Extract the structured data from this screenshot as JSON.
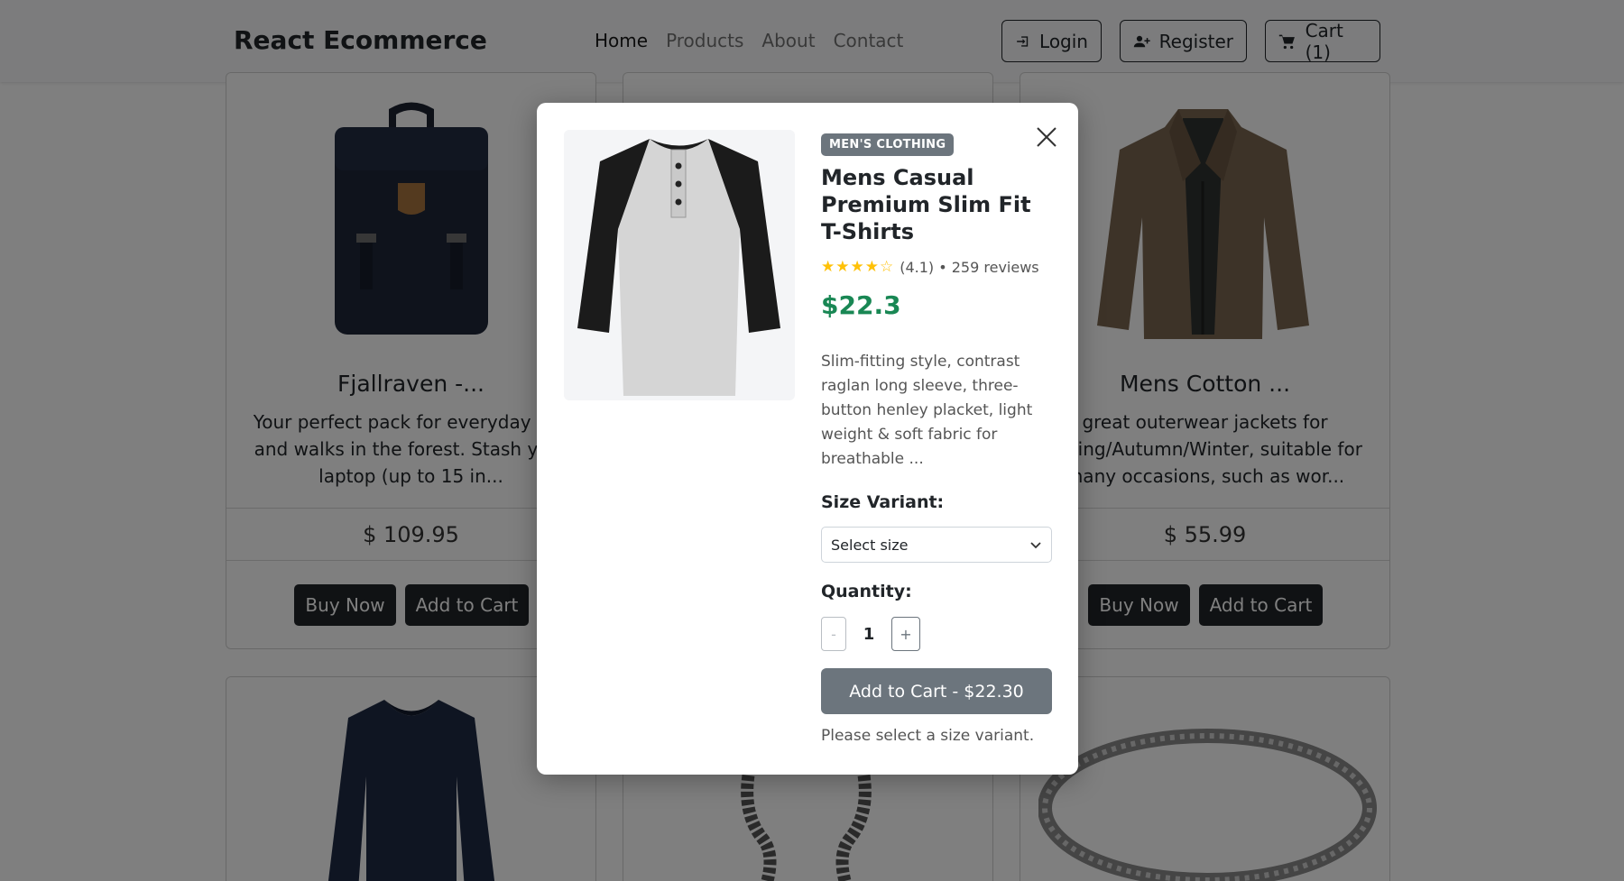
{
  "nav": {
    "brand": "React Ecommerce",
    "links": [
      {
        "label": "Home",
        "active": true
      },
      {
        "label": "Products",
        "active": false
      },
      {
        "label": "About",
        "active": false
      },
      {
        "label": "Contact",
        "active": false
      }
    ],
    "login_label": "Login",
    "register_label": "Register",
    "cart_label": "Cart (1)"
  },
  "products": [
    {
      "title": "Fjallraven -...",
      "description": "Your perfect pack for everyday use and walks in the forest. Stash your laptop (up to 15 in...",
      "price": "$ 109.95"
    },
    {
      "title": "Mens Cotton ...",
      "description": "great outerwear jackets for Spring/Autumn/Winter, suitable for many occasions, such as wor...",
      "price": "$ 55.99"
    }
  ],
  "card_buttons": {
    "buy_now": "Buy Now",
    "add_to_cart": "Add to Cart"
  },
  "modal": {
    "category": "MEN'S CLOTHING",
    "title": "Mens Casual Premium Slim Fit T-Shirts",
    "rating_stars": "★★★★☆",
    "rating_text": "(4.1) • 259 reviews",
    "price": "$22.3",
    "description": "Slim-fitting style, contrast raglan long sleeve, three-button henley placket, light weight & soft fabric for breathable ...",
    "size_label": "Size Variant:",
    "size_select": {
      "selected": "Select size"
    },
    "quantity_label": "Quantity:",
    "quantity": {
      "decrement": "-",
      "value": "1",
      "increment": "+"
    },
    "add_button": "Add to Cart - $22.30",
    "hint": "Please select a size variant."
  },
  "colors": {
    "accent_price": "#198754",
    "badge": "#6c757d",
    "dark_button": "#212529",
    "star": "#ffc107"
  }
}
